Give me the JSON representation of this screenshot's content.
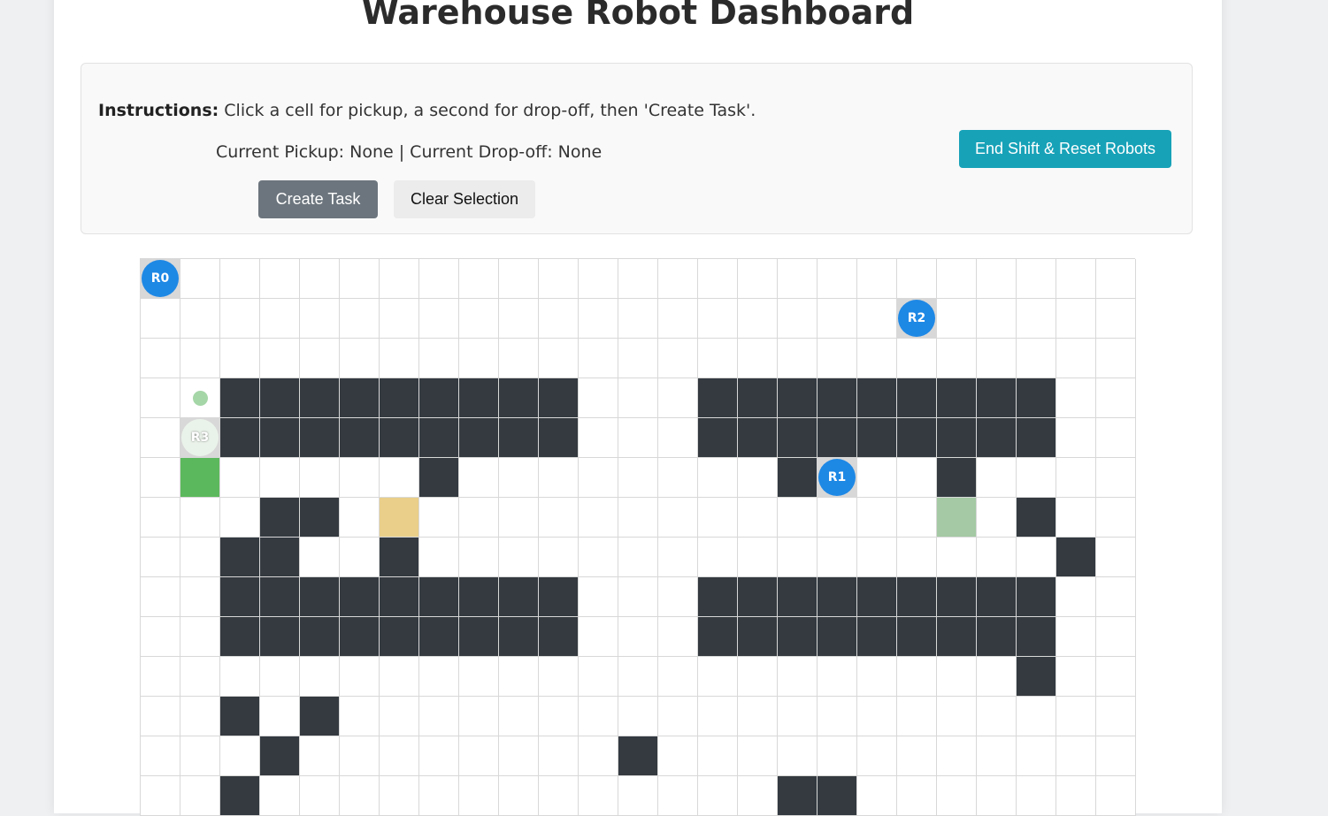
{
  "title": "Warehouse Robot Dashboard",
  "instructions": {
    "label": "Instructions:",
    "text": " Click a cell for pickup, a second for drop-off, then 'Create Task'."
  },
  "current_selection": "Current Pickup: None | Current Drop-off: None",
  "buttons": {
    "create_task": "Create Task",
    "clear_selection": "Clear Selection",
    "end_shift": "End Shift & Reset Robots"
  },
  "grid": {
    "columns": 25,
    "rows": [
      "R..........................",
      "....................R......",
      ".........................",
      ".d#########...#########..",
      ".R#########...#########..",
      ".P.....#.....#R..#.......",
      "...##.T..............G.#.",
      "..##..#..................#",
      "..#########...#########..",
      "..#########...#########..",
      ".......................#.",
      "..#.#....................",
      "...#..........#..........",
      "..#...............##....."
    ],
    "walls": [
      [
        3,
        2
      ],
      [
        3,
        3
      ],
      [
        3,
        4
      ],
      [
        3,
        5
      ],
      [
        3,
        6
      ],
      [
        3,
        7
      ],
      [
        3,
        8
      ],
      [
        3,
        9
      ],
      [
        3,
        10
      ],
      [
        3,
        14
      ],
      [
        3,
        15
      ],
      [
        3,
        16
      ],
      [
        3,
        17
      ],
      [
        3,
        18
      ],
      [
        3,
        19
      ],
      [
        3,
        20
      ],
      [
        3,
        21
      ],
      [
        3,
        22
      ],
      [
        4,
        2
      ],
      [
        4,
        3
      ],
      [
        4,
        4
      ],
      [
        4,
        5
      ],
      [
        4,
        6
      ],
      [
        4,
        7
      ],
      [
        4,
        8
      ],
      [
        4,
        9
      ],
      [
        4,
        10
      ],
      [
        4,
        14
      ],
      [
        4,
        15
      ],
      [
        4,
        16
      ],
      [
        4,
        17
      ],
      [
        4,
        18
      ],
      [
        4,
        19
      ],
      [
        4,
        20
      ],
      [
        4,
        21
      ],
      [
        4,
        22
      ],
      [
        5,
        7
      ],
      [
        5,
        16
      ],
      [
        5,
        20
      ],
      [
        6,
        3
      ],
      [
        6,
        4
      ],
      [
        6,
        22
      ],
      [
        7,
        2
      ],
      [
        7,
        3
      ],
      [
        7,
        6
      ],
      [
        7,
        23
      ],
      [
        8,
        2
      ],
      [
        8,
        3
      ],
      [
        8,
        4
      ],
      [
        8,
        5
      ],
      [
        8,
        6
      ],
      [
        8,
        7
      ],
      [
        8,
        8
      ],
      [
        8,
        9
      ],
      [
        8,
        10
      ],
      [
        8,
        14
      ],
      [
        8,
        15
      ],
      [
        8,
        16
      ],
      [
        8,
        17
      ],
      [
        8,
        18
      ],
      [
        8,
        19
      ],
      [
        8,
        20
      ],
      [
        8,
        21
      ],
      [
        8,
        22
      ],
      [
        9,
        2
      ],
      [
        9,
        3
      ],
      [
        9,
        4
      ],
      [
        9,
        5
      ],
      [
        9,
        6
      ],
      [
        9,
        7
      ],
      [
        9,
        8
      ],
      [
        9,
        9
      ],
      [
        9,
        10
      ],
      [
        9,
        14
      ],
      [
        9,
        15
      ],
      [
        9,
        16
      ],
      [
        9,
        17
      ],
      [
        9,
        18
      ],
      [
        9,
        19
      ],
      [
        9,
        20
      ],
      [
        9,
        21
      ],
      [
        9,
        22
      ],
      [
        10,
        22
      ],
      [
        11,
        2
      ],
      [
        11,
        4
      ],
      [
        12,
        3
      ],
      [
        12,
        12
      ],
      [
        13,
        2
      ],
      [
        13,
        16
      ],
      [
        13,
        17
      ]
    ],
    "robots": [
      {
        "label": "R0",
        "row": 0,
        "col": 0,
        "state": "active"
      },
      {
        "label": "R2",
        "row": 1,
        "col": 19,
        "state": "active"
      },
      {
        "label": "R1",
        "row": 5,
        "col": 17,
        "state": "active"
      },
      {
        "label": "R3",
        "row": 4,
        "col": 1,
        "state": "faded"
      }
    ],
    "markers": {
      "pickup": [
        5,
        1
      ],
      "task_target": [
        6,
        6
      ],
      "dropoff_pending": [
        6,
        20
      ],
      "path_dot": [
        3,
        1
      ]
    }
  },
  "colors": {
    "wall": "#343a40",
    "robot": "#1e88e5",
    "pickup": "#5cb85c",
    "task_target": "#e9cf8a",
    "dropoff_pending": "#a4c9a4",
    "end_shift_button": "#17a2b8",
    "create_task_button": "#6c757d"
  }
}
